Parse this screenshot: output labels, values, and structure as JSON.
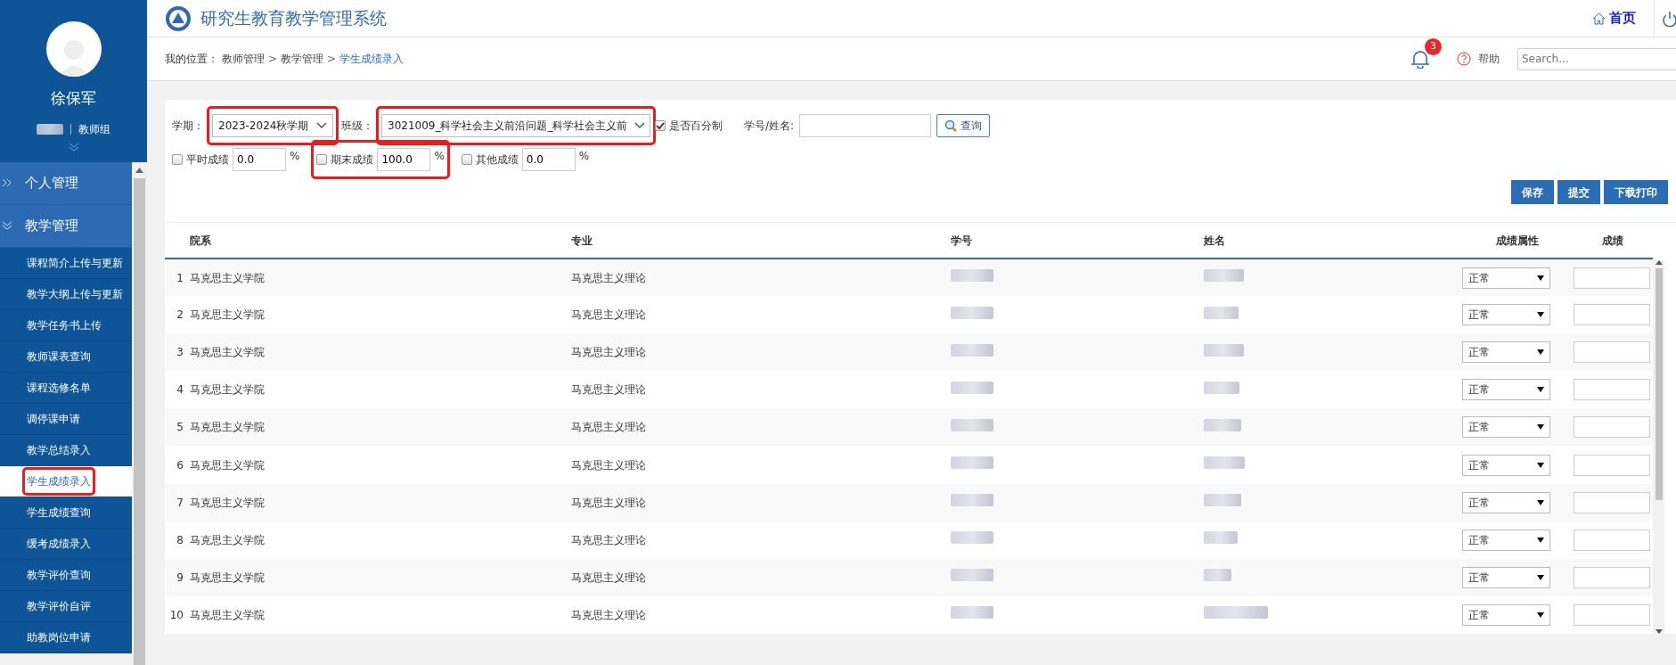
{
  "header": {
    "title": "研究生教育教学管理系统",
    "home": "首页"
  },
  "user": {
    "name": "徐保军",
    "group": "教师组"
  },
  "breadcrumb": {
    "label": "我的位置：",
    "separator": ">",
    "items": [
      {
        "text": "教师管理",
        "current": false
      },
      {
        "text": "教学管理",
        "current": false
      },
      {
        "text": "学生成绩录入",
        "current": true
      }
    ]
  },
  "notifications": {
    "count": "3"
  },
  "help": "帮助",
  "search": {
    "placeholder": "Search..."
  },
  "sidebar": {
    "items": [
      {
        "label": "个人管理",
        "expanded": false
      },
      {
        "label": "教学管理",
        "expanded": true,
        "children": [
          {
            "label": "课程简介上传与更新",
            "selected": false,
            "highlighted": false
          },
          {
            "label": "教学大纲上传与更新",
            "selected": false,
            "highlighted": false
          },
          {
            "label": "教学任务书上传",
            "selected": false,
            "highlighted": false
          },
          {
            "label": "教师课表查询",
            "selected": false,
            "highlighted": false
          },
          {
            "label": "课程选修名单",
            "selected": false,
            "highlighted": false
          },
          {
            "label": "调停课申请",
            "selected": false,
            "highlighted": false
          },
          {
            "label": "教学总结录入",
            "selected": false,
            "highlighted": false
          },
          {
            "label": "学生成绩录入",
            "selected": true,
            "highlighted": true
          },
          {
            "label": "学生成绩查询",
            "selected": false,
            "highlighted": false
          },
          {
            "label": "缓考成绩录入",
            "selected": false,
            "highlighted": false
          },
          {
            "label": "教学评价查询",
            "selected": false,
            "highlighted": false
          },
          {
            "label": "教学评价自评",
            "selected": false,
            "highlighted": false
          },
          {
            "label": "助教岗位申请",
            "selected": false,
            "highlighted": false
          }
        ]
      }
    ]
  },
  "filters": {
    "term": {
      "label": "学期：",
      "value": "2023-2024秋学期",
      "highlighted": true
    },
    "class": {
      "label": "班级：",
      "value": "3021009_科学社会主义前沿问题_科学社会主义前",
      "highlighted": true
    },
    "percent": {
      "label": "是否百分制",
      "checked": true
    },
    "student": {
      "label": "学号/姓名:",
      "button": "查询"
    },
    "weights": [
      {
        "label": "平时成绩",
        "value": "0.0",
        "unit": "%",
        "checked": false,
        "highlighted": false
      },
      {
        "label": "期末成绩",
        "value": "100.0",
        "unit": "%",
        "checked": false,
        "highlighted": true
      },
      {
        "label": "其他成绩",
        "value": "0.0",
        "unit": "%",
        "checked": false,
        "highlighted": false
      }
    ]
  },
  "actions": [
    "保存",
    "提交",
    "下载打印"
  ],
  "table": {
    "columns": [
      "院系",
      "专业",
      "学号",
      "姓名",
      "成绩属性",
      "成绩"
    ],
    "rows": [
      {
        "index": "1",
        "department": "马克思主义学院",
        "major": "马克思主义理论",
        "attribute": "正常"
      },
      {
        "index": "2",
        "department": "马克思主义学院",
        "major": "马克思主义理论",
        "attribute": "正常"
      },
      {
        "index": "3",
        "department": "马克思主义学院",
        "major": "马克思主义理论",
        "attribute": "正常"
      },
      {
        "index": "4",
        "department": "马克思主义学院",
        "major": "马克思主义理论",
        "attribute": "正常"
      },
      {
        "index": "5",
        "department": "马克思主义学院",
        "major": "马克思主义理论",
        "attribute": "正常"
      },
      {
        "index": "6",
        "department": "马克思主义学院",
        "major": "马克思主义理论",
        "attribute": "正常"
      },
      {
        "index": "7",
        "department": "马克思主义学院",
        "major": "马克思主义理论",
        "attribute": "正常"
      },
      {
        "index": "8",
        "department": "马克思主义学院",
        "major": "马克思主义理论",
        "attribute": "正常"
      },
      {
        "index": "9",
        "department": "马克思主义学院",
        "major": "马克思主义理论",
        "attribute": "正常"
      },
      {
        "index": "10",
        "department": "马克思主义学院",
        "major": "马克思主义理论",
        "attribute": "正常"
      }
    ]
  }
}
